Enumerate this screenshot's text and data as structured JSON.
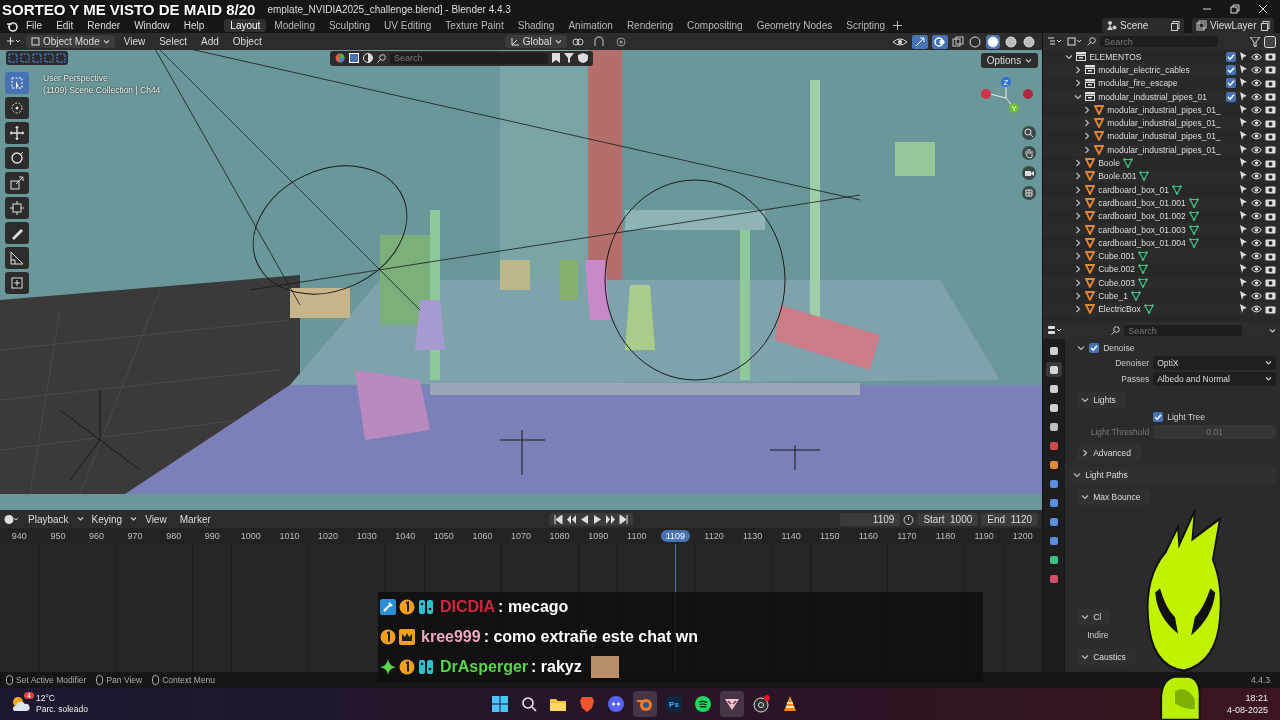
{
  "stream_overlay": {
    "title": "SORTEO Y ME VISTO DE MAID 8/20"
  },
  "window": {
    "title": "emplate_NVIDIA2025_challenge.blend] - Blender 4.4.3"
  },
  "menu": [
    "File",
    "Edit",
    "Render",
    "Window",
    "Help"
  ],
  "workspaces": [
    {
      "label": "Layout",
      "selected": true
    },
    {
      "label": "Modeling",
      "selected": false
    },
    {
      "label": "Sculpting",
      "selected": false
    },
    {
      "label": "UV Editing",
      "selected": false
    },
    {
      "label": "Texture Paint",
      "selected": false
    },
    {
      "label": "Shading",
      "selected": false
    },
    {
      "label": "Animation",
      "selected": false
    },
    {
      "label": "Rendering",
      "selected": false
    },
    {
      "label": "Compositing",
      "selected": false
    },
    {
      "label": "Geometry Nodes",
      "selected": false
    },
    {
      "label": "Scripting",
      "selected": false
    }
  ],
  "scene": {
    "name": "Scene",
    "view_layer": "ViewLayer"
  },
  "viewport": {
    "mode": "Object Mode",
    "menus": [
      "View",
      "Select",
      "Add",
      "Object"
    ],
    "orientation": "Global",
    "search": {
      "placeholder": "Search"
    },
    "options": "Options",
    "view_name": "User Perspective",
    "collection_info": "(1109) Scene Collection | Ch44",
    "gizmo_axes": [
      "Z",
      "Y"
    ],
    "tools": [
      {
        "selected": true
      },
      {
        "selected": false
      },
      {
        "selected": false
      },
      {
        "selected": false
      },
      {
        "selected": false
      },
      {
        "selected": false
      },
      {
        "selected": false
      },
      {
        "selected": false
      },
      {
        "selected": false
      }
    ],
    "shading": [
      {
        "selected": false
      },
      {
        "selected": true
      },
      {
        "selected": false
      },
      {
        "selected": false
      }
    ]
  },
  "timeline": {
    "menus": [
      "Playback",
      "Keying",
      "View",
      "Marker"
    ],
    "frame": "1109",
    "start_label": "Start",
    "start": "1000",
    "end_label": "End",
    "end": "1120",
    "ticks": [
      {
        "label": "940",
        "selected": false
      },
      {
        "label": "950",
        "selected": false
      },
      {
        "label": "960",
        "selected": false
      },
      {
        "label": "970",
        "selected": false
      },
      {
        "label": "980",
        "selected": false
      },
      {
        "label": "990",
        "selected": false
      },
      {
        "label": "1000",
        "selected": false
      },
      {
        "label": "1010",
        "selected": false
      },
      {
        "label": "1020",
        "selected": false
      },
      {
        "label": "1030",
        "selected": false
      },
      {
        "label": "1040",
        "selected": false
      },
      {
        "label": "1050",
        "selected": false
      },
      {
        "label": "1060",
        "selected": false
      },
      {
        "label": "1070",
        "selected": false
      },
      {
        "label": "1080",
        "selected": false
      },
      {
        "label": "1090",
        "selected": false
      },
      {
        "label": "1100",
        "selected": false
      },
      {
        "label": "1109",
        "selected": true
      },
      {
        "label": "1120",
        "selected": false
      },
      {
        "label": "1130",
        "selected": false
      },
      {
        "label": "1140",
        "selected": false
      },
      {
        "label": "1150",
        "selected": false
      },
      {
        "label": "1160",
        "selected": false
      },
      {
        "label": "1170",
        "selected": false
      },
      {
        "label": "1180",
        "selected": false
      },
      {
        "label": "1190",
        "selected": false
      },
      {
        "label": "1200",
        "selected": false
      }
    ]
  },
  "chat": [
    {
      "badges": [
        {
          "kind": "hammer"
        },
        {
          "kind": "one"
        },
        {
          "kind": "controller"
        }
      ],
      "user": "DICDIA",
      "color": "#d0243f",
      "text": ": mecago",
      "emote": false
    },
    {
      "badges": [
        {
          "kind": "one"
        },
        {
          "kind": "crown"
        }
      ],
      "user": "kree999",
      "color": "#f0a6c4",
      "text": ": como extrañe este chat wn",
      "emote": false
    },
    {
      "badges": [
        {
          "kind": "plus"
        },
        {
          "kind": "one"
        },
        {
          "kind": "controller"
        }
      ],
      "user": "DrAsperger",
      "color": "#58d64a",
      "text": ": rakyz",
      "emote": true
    }
  ],
  "outliner": {
    "search": {
      "placeholder": "Search"
    },
    "items": [
      {
        "name": "ELEMENTOS",
        "kind": "collection",
        "expanded": true,
        "checked": true,
        "data_icon": false,
        "children": [
          {
            "name": "modular_electric_cables",
            "kind": "collection",
            "expanded": false,
            "checked": true,
            "data_icon": false
          },
          {
            "name": "modular_fire_escape",
            "kind": "collection",
            "expanded": false,
            "checked": true,
            "data_icon": false
          },
          {
            "name": "modular_industrial_pipes_01",
            "kind": "collection",
            "expanded": true,
            "checked": true,
            "data_icon": false,
            "children": [
              {
                "name": "modular_industrial_pipes_01_",
                "kind": "mesh",
                "expanded": false,
                "data_icon": false
              },
              {
                "name": "modular_industrial_pipes_01_",
                "kind": "mesh",
                "expanded": false,
                "data_icon": false
              },
              {
                "name": "modular_industrial_pipes_01_",
                "kind": "mesh",
                "expanded": false,
                "data_icon": false
              },
              {
                "name": "modular_industrial_pipes_01_",
                "kind": "mesh",
                "expanded": false,
                "data_icon": false
              }
            ]
          },
          {
            "name": "Boole",
            "kind": "mesh",
            "expanded": false,
            "data_icon": true
          },
          {
            "name": "Boole.001",
            "kind": "mesh",
            "expanded": false,
            "data_icon": true
          },
          {
            "name": "cardboard_box_01",
            "kind": "mesh",
            "expanded": false,
            "data_icon": true
          },
          {
            "name": "cardboard_box_01.001",
            "kind": "mesh",
            "expanded": false,
            "data_icon": true
          },
          {
            "name": "cardboard_box_01.002",
            "kind": "mesh",
            "expanded": false,
            "data_icon": true
          },
          {
            "name": "cardboard_box_01.003",
            "kind": "mesh",
            "expanded": false,
            "data_icon": true
          },
          {
            "name": "cardboard_box_01.004",
            "kind": "mesh",
            "expanded": false,
            "data_icon": true
          },
          {
            "name": "Cube.001",
            "kind": "mesh",
            "expanded": false,
            "data_icon": true
          },
          {
            "name": "Cube.002",
            "kind": "mesh",
            "expanded": false,
            "data_icon": true
          },
          {
            "name": "Cube.003",
            "kind": "mesh",
            "expanded": false,
            "data_icon": true
          },
          {
            "name": "Cube_1",
            "kind": "mesh",
            "expanded": false,
            "data_icon": true
          },
          {
            "name": "ElectricBox",
            "kind": "mesh",
            "expanded": false,
            "data_icon": true
          }
        ]
      }
    ]
  },
  "properties": {
    "search": {
      "placeholder": "Search"
    },
    "tabs": [
      {
        "color": "#cfcfcf",
        "selected": false
      },
      {
        "color": "#d8d8d8",
        "selected": true
      },
      {
        "color": "#cfcfcf",
        "selected": false
      },
      {
        "color": "#cfcfcf",
        "selected": false
      },
      {
        "color": "#bfbfbf",
        "selected": false
      },
      {
        "color": "#d04a4a",
        "selected": false
      },
      {
        "color": "#e08a3a",
        "selected": false
      },
      {
        "color": "#5a8fe0",
        "selected": false
      },
      {
        "color": "#5a8fe0",
        "selected": false
      },
      {
        "color": "#5a8fe0",
        "selected": false
      },
      {
        "color": "#5a8fe0",
        "selected": false
      },
      {
        "color": "#3fbf7f",
        "selected": false
      },
      {
        "color": "#d0506a",
        "selected": false
      }
    ],
    "rows": [
      {
        "kind": "check_panel",
        "label": "Denoise",
        "checked": true,
        "expanded": true
      },
      {
        "kind": "select",
        "label": "Denoiser",
        "value": "OptiX"
      },
      {
        "kind": "select",
        "label": "Passes",
        "value": "Albedo and Normal"
      },
      {
        "kind": "subpanel",
        "label": "Lights",
        "expanded": true
      },
      {
        "kind": "checkbox",
        "label": "Light Tree",
        "checked": true
      },
      {
        "kind": "number",
        "label": "Light Threshold",
        "value": "0.01",
        "disabled": true
      },
      {
        "kind": "subpanel",
        "label": "Advanced",
        "expanded": false
      },
      {
        "kind": "panel",
        "label": "Light Paths",
        "expanded": true
      },
      {
        "kind": "subpanel",
        "label": "Max Bounce",
        "expanded": true
      },
      {
        "kind": "gap"
      },
      {
        "kind": "subpanel",
        "label": "Cl",
        "expanded": true
      },
      {
        "kind": "label",
        "label": "Indire"
      },
      {
        "kind": "subpanel",
        "label": "Caustics",
        "expanded": true
      }
    ]
  },
  "status_bar": {
    "hints": [
      "Set Active Modifier",
      "Pan View",
      "Context Menu"
    ],
    "version": "4.4.3"
  },
  "taskbar": {
    "weather": {
      "temperature": "12°C",
      "description": "Parc. soleado",
      "badge": "4"
    },
    "apps": [
      {
        "kind": "start",
        "active": false
      },
      {
        "kind": "search",
        "active": false
      },
      {
        "kind": "folder",
        "active": false
      },
      {
        "kind": "brave",
        "active": false
      },
      {
        "kind": "discord",
        "active": false
      },
      {
        "kind": "blender",
        "active": true
      },
      {
        "kind": "photoshop",
        "label": "Ps",
        "active": false
      },
      {
        "kind": "spotify",
        "active": false
      },
      {
        "kind": "vtube",
        "active": true
      },
      {
        "kind": "obs",
        "active": false
      },
      {
        "kind": "vlc",
        "active": false
      }
    ],
    "time": "18:21",
    "date": "4-08-2025"
  }
}
